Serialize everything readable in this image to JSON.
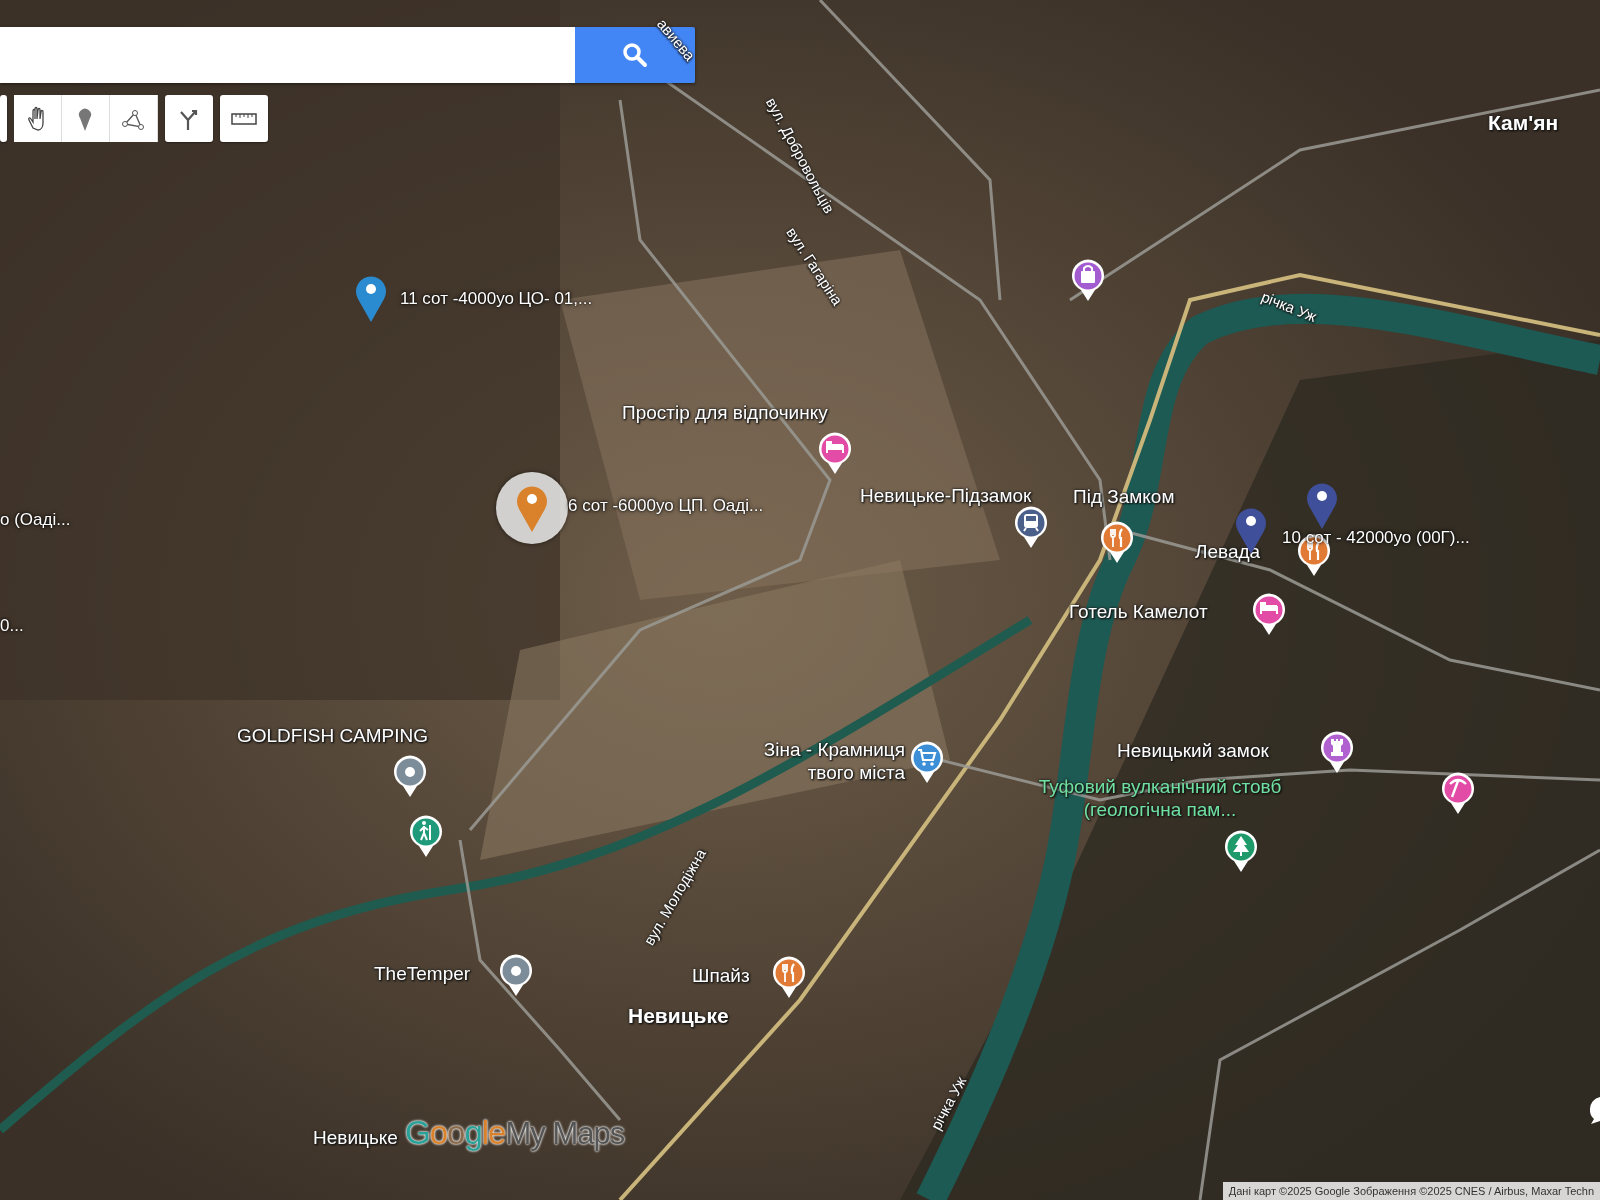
{
  "map": {
    "custom_markers": [
      {
        "kind": "pin",
        "label": "11 сот -4000уо ЦО- 01,...",
        "color": "#2a8bd0",
        "selected": false
      },
      {
        "kind": "pin",
        "label": "6 сот -6000уо ЦП. Оаді...",
        "color": "#d9822b",
        "selected": true
      },
      {
        "kind": "pin",
        "label": "10 сот - 42000уо (00Г)...",
        "color": "#3f4f9a",
        "selected": false
      },
      {
        "kind": "pin",
        "color": "#3f4f9a",
        "selected": false
      }
    ],
    "edge_labels": [
      {
        "label": "о (Оаді..."
      },
      {
        "label": "0..."
      }
    ],
    "places": [
      {
        "kind": "lodging",
        "label": "Простір для відпочинку",
        "color": "#e24ba6"
      },
      {
        "kind": "station",
        "label": "Невицьке-Підзамок",
        "color": "#4a5f8a"
      },
      {
        "kind": "restaurant",
        "label": "Під Замком",
        "color": "#e07a35"
      },
      {
        "kind": "restaurant",
        "label": "Левада",
        "color": "#e07a35"
      },
      {
        "kind": "lodging",
        "label": "Готель Камелот",
        "color": "#e24ba6"
      },
      {
        "kind": "shop",
        "label": "Зіна - Крамниця твого міста",
        "color": "#3c8fd6"
      },
      {
        "kind": "castle",
        "label": "Невицький замок",
        "color": "#b160d0"
      },
      {
        "kind": "park",
        "label": "Туфовий вулканічний стовб (геологічна пам...",
        "color": "#1f9a6a"
      },
      {
        "kind": "tool",
        "color": "#e24ba6"
      },
      {
        "kind": "bag",
        "color": "#a35bd0"
      },
      {
        "kind": "generic",
        "label": "GOLDFISH CAMPING",
        "color": "#7d8c99"
      },
      {
        "kind": "hiking",
        "color": "#1f9a7a"
      },
      {
        "kind": "generic",
        "label": "TheTemper",
        "color": "#7d8c99"
      },
      {
        "kind": "restaurant",
        "label": "Шпайз",
        "color": "#e07a35"
      }
    ],
    "areas": [
      {
        "kind": "town",
        "label": "Невицьке"
      },
      {
        "kind": "village",
        "label": "Невицьке"
      },
      {
        "kind": "town",
        "label": "Кам'ян"
      }
    ],
    "streets": [
      {
        "label": "вул. Добровольців"
      },
      {
        "label": "вул. Гагаріна"
      },
      {
        "label": "вул. Молодіжна"
      },
      {
        "label": "річка Уж"
      },
      {
        "label": "річка Уж"
      },
      {
        "label": "авиева"
      }
    ],
    "logo": {
      "first": "Google",
      "second": "My Maps"
    },
    "attribution": "Дані карт ©2025 Google Зображення ©2025 CNES / Airbus, Maxar Techn"
  }
}
